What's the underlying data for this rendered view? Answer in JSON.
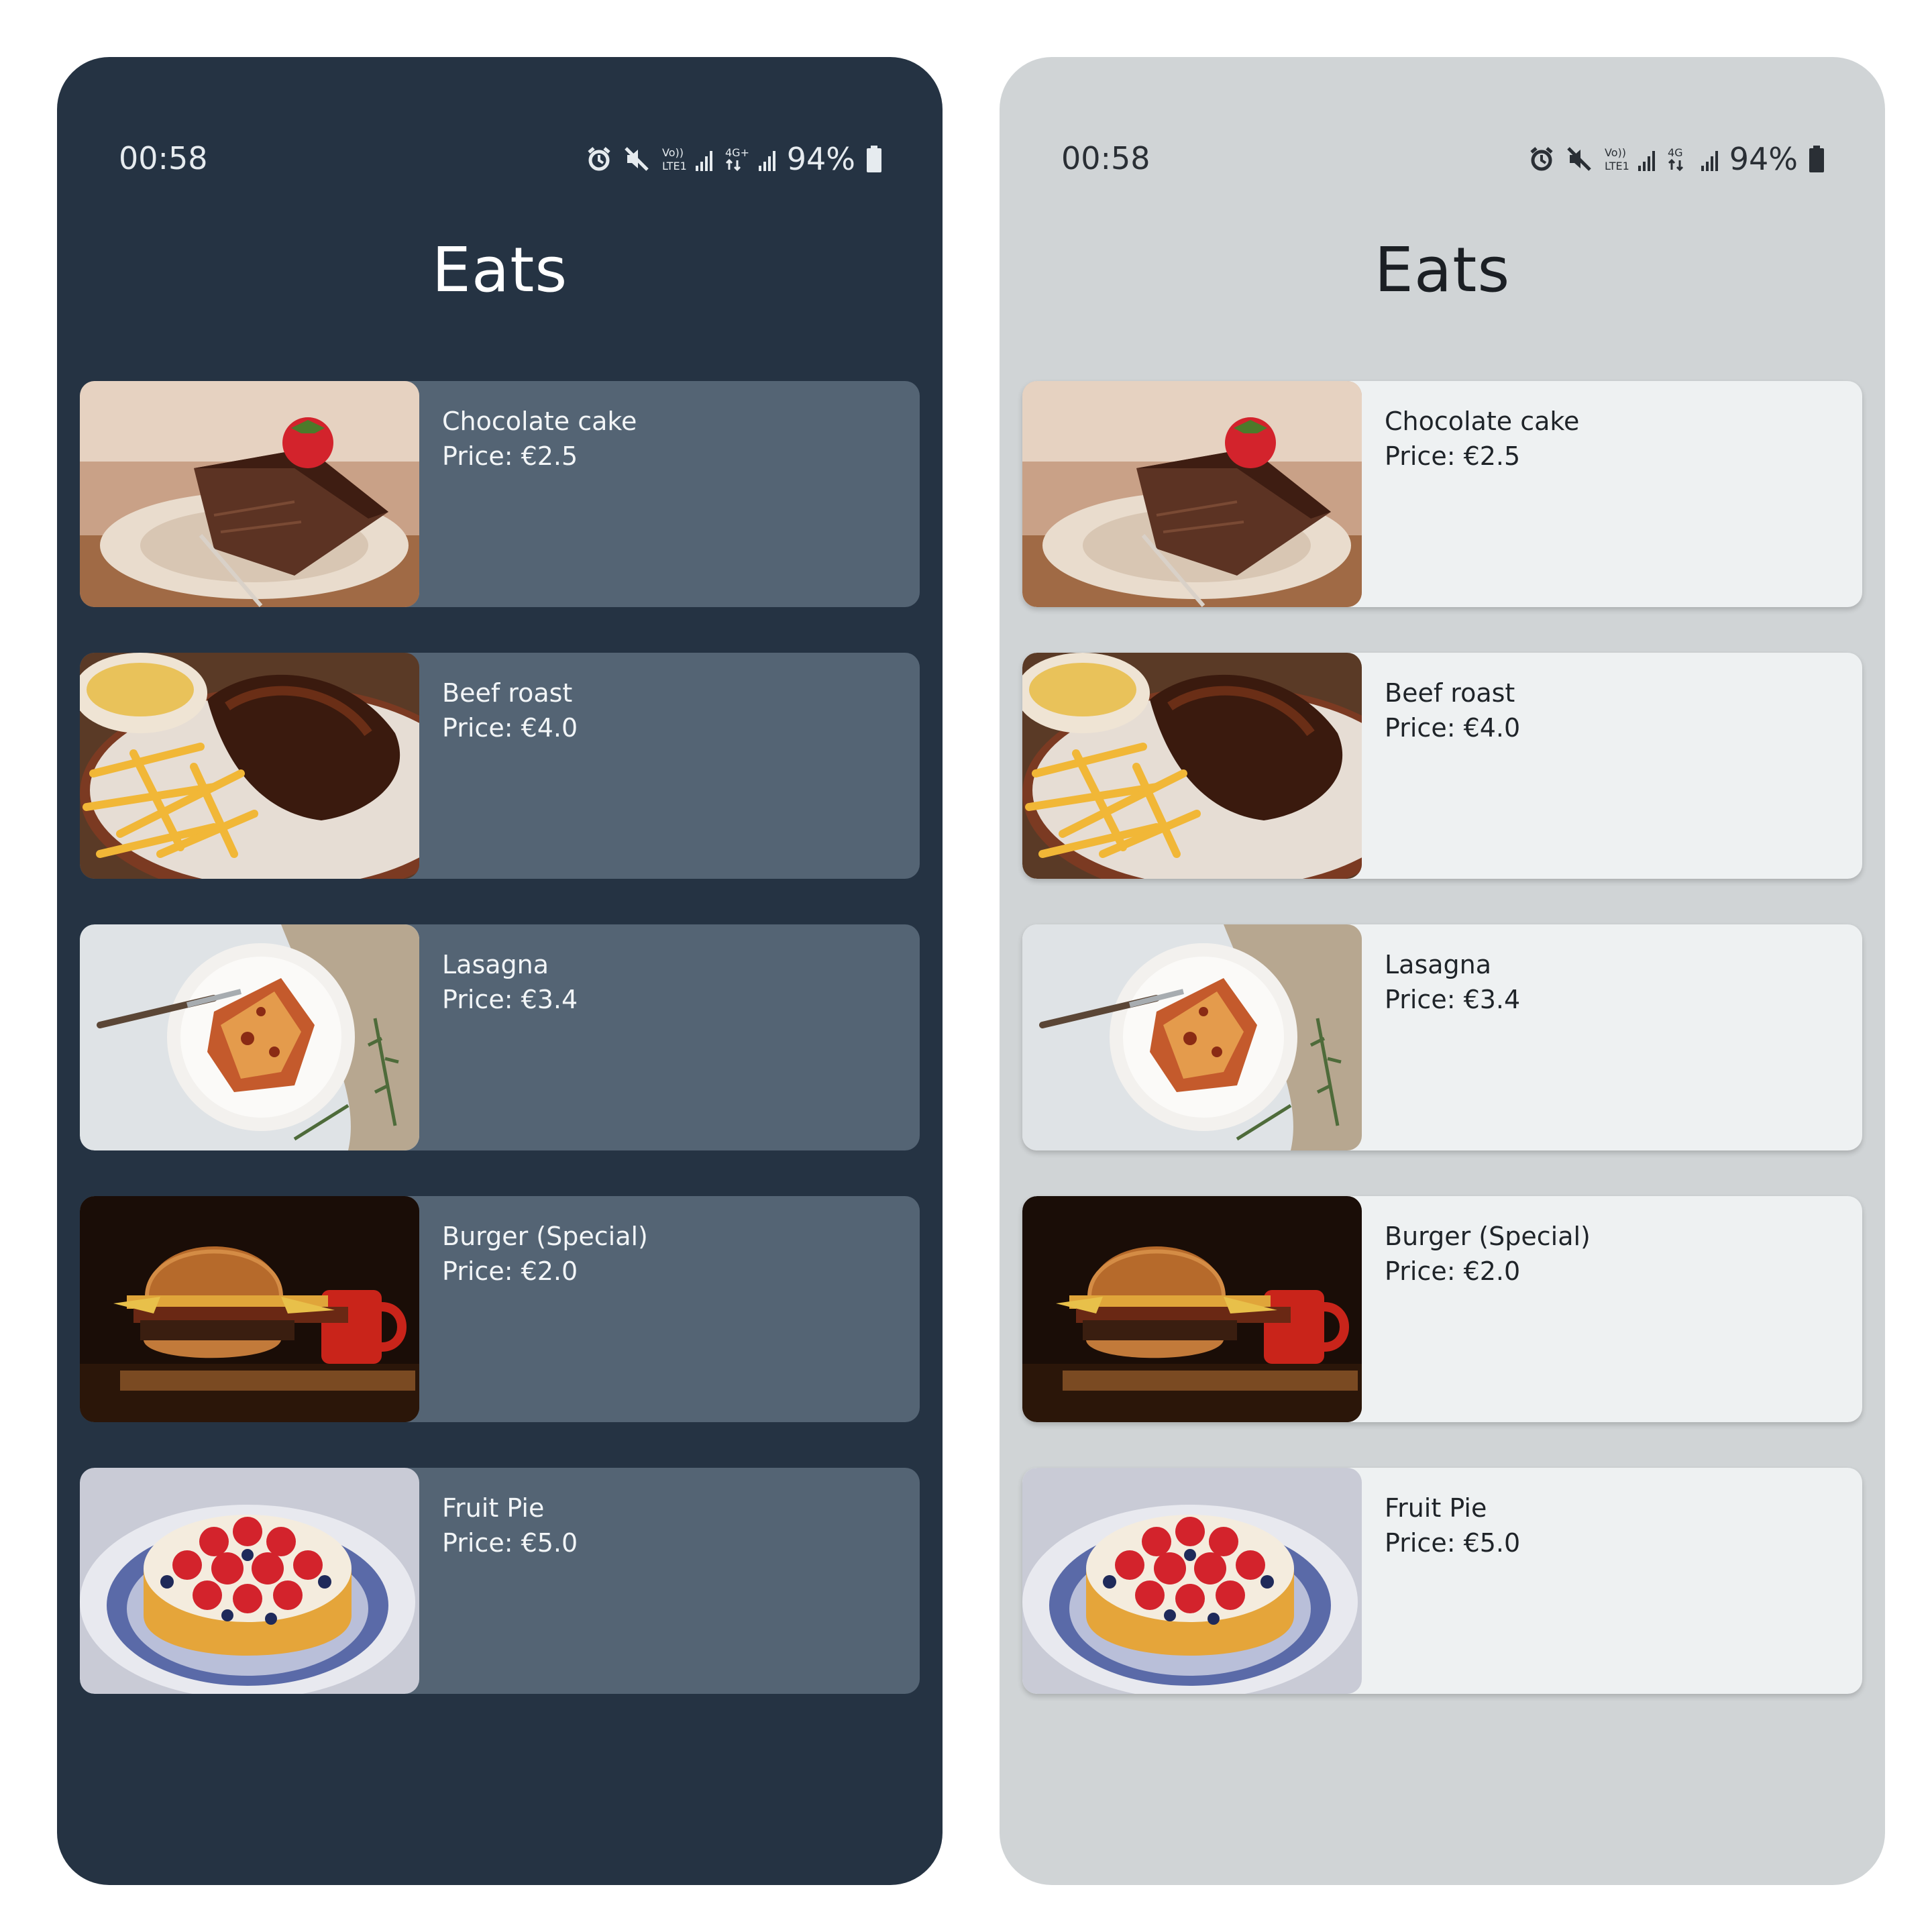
{
  "screens": [
    {
      "theme": "dark",
      "status_bar": {
        "time": "00:58",
        "battery": "94%"
      },
      "app_title": "Eats",
      "items": [
        {
          "name": "Chocolate cake",
          "price": "Price: €2.5"
        },
        {
          "name": "Beef roast",
          "price": "Price: €4.0"
        },
        {
          "name": "Lasagna",
          "price": "Price: €3.4"
        },
        {
          "name": "Burger (Special)",
          "price": "Price: €2.0"
        },
        {
          "name": "Fruit Pie",
          "price": "Price: €5.0"
        }
      ]
    },
    {
      "theme": "light",
      "status_bar": {
        "time": "00:58",
        "battery": "94%"
      },
      "app_title": "Eats",
      "items": [
        {
          "name": "Chocolate cake",
          "price": "Price: €2.5"
        },
        {
          "name": "Beef roast",
          "price": "Price: €4.0"
        },
        {
          "name": "Lasagna",
          "price": "Price: €3.4"
        },
        {
          "name": "Burger (Special)",
          "price": "Price: €2.0"
        },
        {
          "name": "Fruit Pie",
          "price": "Price: €5.0"
        }
      ]
    }
  ],
  "colors": {
    "dark_background": "#253343",
    "dark_card": "#546474",
    "light_background": "#d0d4d6",
    "light_card": "#eef1f2"
  },
  "icons": [
    "alarm-icon",
    "mute-icon",
    "volte-signal-icon",
    "4g-signal-icon",
    "battery-icon"
  ]
}
